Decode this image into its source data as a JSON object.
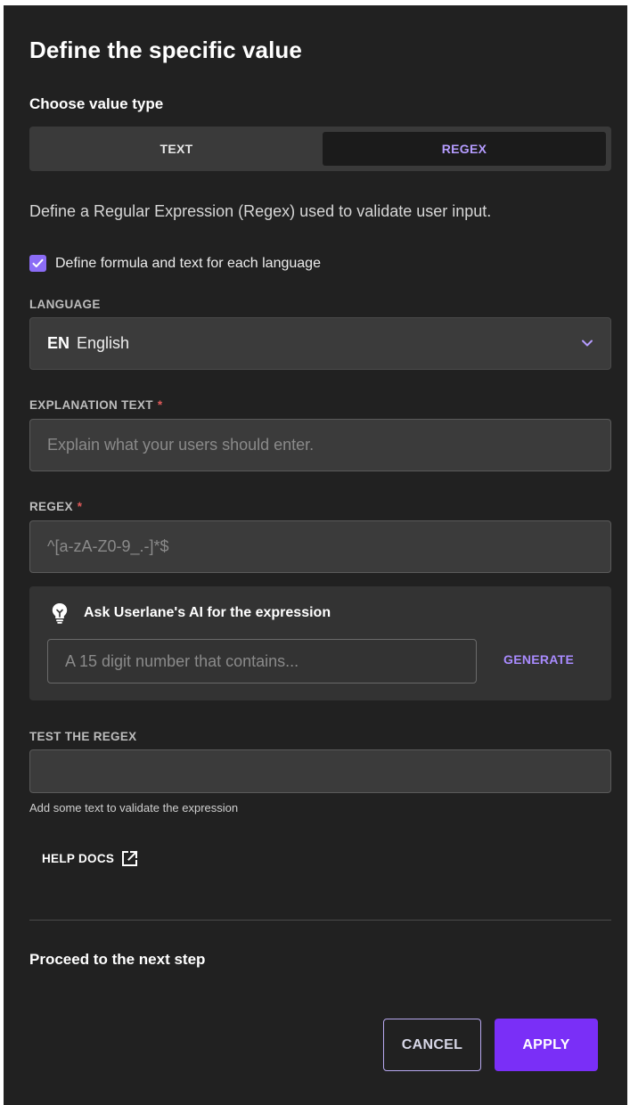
{
  "dialog": {
    "title": "Define the specific value",
    "value_type_label": "Choose value type",
    "tabs": [
      {
        "label": "TEXT",
        "selected": false
      },
      {
        "label": "REGEX",
        "selected": true
      }
    ],
    "description": "Define a Regular Expression (Regex) used to validate user input.",
    "per_language_checkbox": {
      "label": "Define formula and text for each language",
      "checked": true
    }
  },
  "language": {
    "label": "LANGUAGE",
    "code": "EN",
    "name": "English"
  },
  "explanation": {
    "label": "EXPLANATION TEXT",
    "required_mark": "*",
    "value": "",
    "placeholder": "Explain what your users should enter."
  },
  "regex": {
    "label": "REGEX",
    "required_mark": "*",
    "value": "",
    "placeholder": "^[a-zA-Z0-9_.-]*$"
  },
  "ai": {
    "title": "Ask Userlane's AI for the expression",
    "placeholder": "A 15 digit number that contains...",
    "generate_label": "GENERATE"
  },
  "test": {
    "label": "TEST THE REGEX",
    "value": "",
    "hint": "Add some text to validate the expression"
  },
  "help": {
    "label": "HELP DOCS"
  },
  "footer": {
    "next_step": "Proceed to the next step",
    "cancel_label": "CANCEL",
    "apply_label": "APPLY"
  },
  "colors": {
    "background": "#212121",
    "accent": "#7a2ff7",
    "accent_text": "#b59cff",
    "checkbox": "#8b6cf6",
    "required": "#e05a5a"
  }
}
